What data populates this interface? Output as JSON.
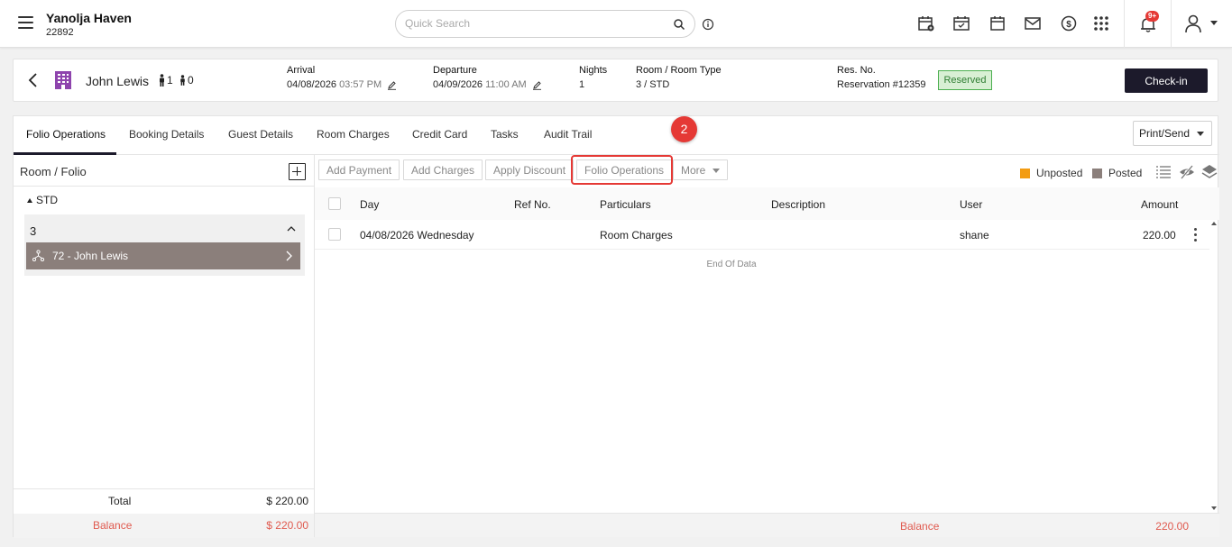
{
  "app": {
    "hotel_name": "Yanolja Haven",
    "hotel_code": "22892",
    "search_placeholder": "Quick Search",
    "notification_badge": "9+"
  },
  "reservation": {
    "guest_name": "John Lewis",
    "adults": "1",
    "children": "0",
    "arrival_label": "Arrival",
    "arrival_date": "04/08/2026",
    "arrival_time": "03:57 PM",
    "departure_label": "Departure",
    "departure_date": "04/09/2026",
    "departure_time": "11:00 AM",
    "nights_label": "Nights",
    "nights": "1",
    "room_label": "Room / Room Type",
    "room": "3 / STD",
    "res_no_label": "Res. No.",
    "res_no": "Reservation #12359",
    "status": "Reserved",
    "checkin_label": "Check-in"
  },
  "tabs": [
    "Folio Operations",
    "Booking Details",
    "Guest Details",
    "Room Charges",
    "Credit Card",
    "Tasks",
    "Audit Trail"
  ],
  "step_badge": "2",
  "print_send_label": "Print/Send",
  "left_panel": {
    "title": "Room / Folio",
    "room_type": "STD",
    "room_number": "3",
    "folio": "72 - John Lewis",
    "total_label": "Total",
    "total_value": "$ 220.00",
    "balance_label": "Balance",
    "balance_value": "$ 220.00"
  },
  "actions": {
    "add_payment": "Add Payment",
    "add_charges": "Add Charges",
    "apply_discount": "Apply Discount",
    "folio_operations": "Folio Operations",
    "more": "More"
  },
  "legend": {
    "unposted": "Unposted",
    "unposted_color": "#f39c12",
    "posted": "Posted",
    "posted_color": "#8b7f7b"
  },
  "table": {
    "columns": [
      "Day",
      "Ref No.",
      "Particulars",
      "Description",
      "User",
      "Amount"
    ],
    "rows": [
      {
        "day": "04/08/2026 Wednesday",
        "ref": "",
        "particulars": "Room Charges",
        "description": "",
        "user": "shane",
        "amount": "220.00"
      }
    ],
    "end_text": "End Of Data"
  },
  "footer": {
    "balance_label": "Balance",
    "balance_value": "220.00"
  }
}
